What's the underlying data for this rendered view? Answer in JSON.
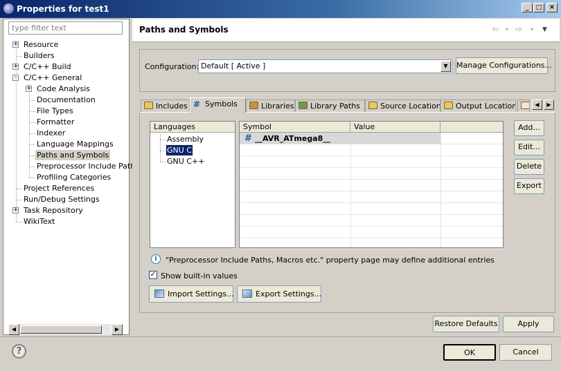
{
  "window": {
    "title": "Properties for test1",
    "min": "_",
    "max": "□",
    "close": "×"
  },
  "filter": {
    "placeholder": "type filter text"
  },
  "tree": [
    {
      "label": "Resource",
      "level": 0,
      "expander": "+"
    },
    {
      "label": "Builders",
      "level": 0
    },
    {
      "label": "C/C++ Build",
      "level": 0,
      "expander": "+"
    },
    {
      "label": "C/C++ General",
      "level": 0,
      "expander": "-"
    },
    {
      "label": "Code Analysis",
      "level": 1,
      "expander": "+"
    },
    {
      "label": "Documentation",
      "level": 1
    },
    {
      "label": "File Types",
      "level": 1
    },
    {
      "label": "Formatter",
      "level": 1
    },
    {
      "label": "Indexer",
      "level": 1
    },
    {
      "label": "Language Mappings",
      "level": 1
    },
    {
      "label": "Paths and Symbols",
      "level": 1,
      "selected": true
    },
    {
      "label": "Preprocessor Include Path",
      "level": 1
    },
    {
      "label": "Profiling Categories",
      "level": 1
    },
    {
      "label": "Project References",
      "level": 0
    },
    {
      "label": "Run/Debug Settings",
      "level": 0
    },
    {
      "label": "Task Repository",
      "level": 0,
      "expander": "+"
    },
    {
      "label": "WikiText",
      "level": 0
    }
  ],
  "page": {
    "title": "Paths and Symbols"
  },
  "config": {
    "label": "Configuration:",
    "value": "Default  [ Active ]",
    "manage_button": "Manage Configurations..."
  },
  "tabs": [
    {
      "label": "Includes",
      "icon": "includes-icon"
    },
    {
      "label": "Symbols",
      "icon": "hash-icon",
      "active": true
    },
    {
      "label": "Libraries",
      "icon": "libraries-icon"
    },
    {
      "label": "Library Paths",
      "icon": "library-paths-icon"
    },
    {
      "label": "Source Location",
      "icon": "folder-icon"
    },
    {
      "label": "Output Location",
      "icon": "folder-icon"
    }
  ],
  "languages": {
    "header": "Languages",
    "items": [
      "Assembly",
      "GNU C",
      "GNU C++"
    ],
    "selected": "GNU C"
  },
  "symbols": {
    "headers": [
      "Symbol",
      "Value"
    ],
    "rows": [
      {
        "symbol": "__AVR_ATmega8__",
        "value": ""
      }
    ]
  },
  "side_buttons": {
    "add": "Add...",
    "edit": "Edit...",
    "delete": "Delete",
    "export": "Export"
  },
  "info": {
    "text": "\"Preprocessor Include Paths, Macros etc.\" property page may define additional entries"
  },
  "show_builtin": {
    "label": "Show built-in values",
    "checked": true
  },
  "import_button": "Import Settings...",
  "export_settings_button": "Export Settings...",
  "restore_defaults": "Restore Defaults",
  "apply": "Apply",
  "ok": "OK",
  "cancel": "Cancel",
  "help": "?"
}
